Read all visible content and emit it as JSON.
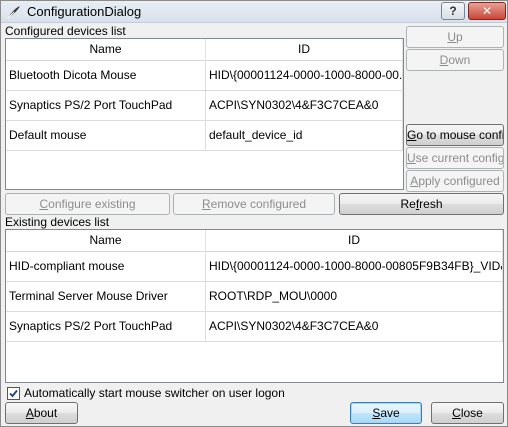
{
  "window": {
    "title": "ConfigurationDialog"
  },
  "configured": {
    "label": "Configured devices list",
    "columns": [
      "Name",
      "ID"
    ],
    "rows": [
      {
        "name": "Bluetooth Dicota Mouse",
        "id": "HID\\{00001124-0000-1000-8000-00..."
      },
      {
        "name": "Synaptics PS/2 Port TouchPad",
        "id": "ACPI\\SYN0302\\4&F3C7CEA&0"
      },
      {
        "name": "Default mouse",
        "id": "default_device_id"
      }
    ]
  },
  "side_buttons": {
    "up": {
      "pre": "",
      "u": "U",
      "post": "p"
    },
    "down": {
      "pre": "",
      "u": "D",
      "post": "own"
    },
    "goto": {
      "pre": "",
      "u": "G",
      "post": "o to mouse config"
    },
    "use_current": {
      "pre": "",
      "u": "U",
      "post": "se current config"
    },
    "apply": {
      "pre": "",
      "u": "A",
      "post": "pply configured"
    }
  },
  "mid_buttons": {
    "configure": {
      "pre": "",
      "u": "C",
      "post": "onfigure existing"
    },
    "remove": {
      "pre": "",
      "u": "R",
      "post": "emove configured"
    },
    "refresh": {
      "pre": "Re",
      "u": "f",
      "post": "resh"
    }
  },
  "existing": {
    "label": "Existing devices list",
    "columns": [
      "Name",
      "ID"
    ],
    "rows": [
      {
        "name": "HID-compliant mouse",
        "id": "HID\\{00001124-0000-1000-8000-00805F9B34FB}_VID&..."
      },
      {
        "name": "Terminal Server Mouse Driver",
        "id": "ROOT\\RDP_MOU\\0000"
      },
      {
        "name": "Synaptics PS/2 Port TouchPad",
        "id": "ACPI\\SYN0302\\4&F3C7CEA&0"
      }
    ]
  },
  "autostart": {
    "label": "Automatically start mouse switcher on user logon",
    "checked": true
  },
  "bottom_buttons": {
    "about": {
      "pre": "",
      "u": "A",
      "post": "bout"
    },
    "save": {
      "pre": "",
      "u": "S",
      "post": "ave"
    },
    "close": {
      "pre": "",
      "u": "C",
      "post": "lose"
    }
  },
  "titlebar_buttons": {
    "help": "?",
    "close": "✕"
  }
}
